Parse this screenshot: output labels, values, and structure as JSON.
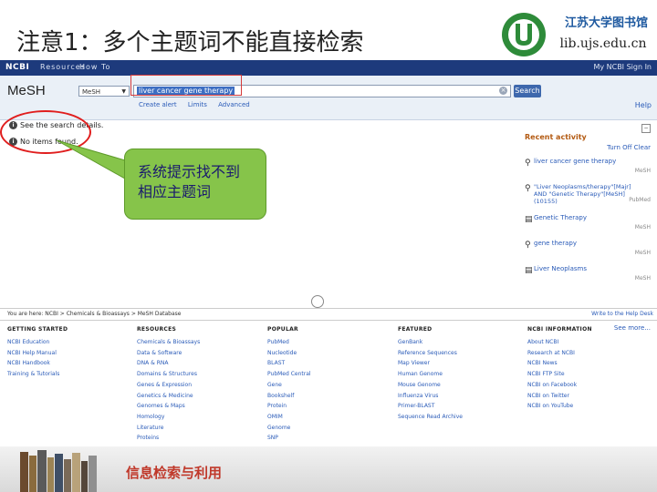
{
  "slide": {
    "title": "注意1：多个主题词不能直接检索",
    "library_name": "江苏大学图书馆",
    "library_url": "lib.ujs.edu.cn",
    "caption": "信息检索与利用"
  },
  "ncbi_bar": {
    "logo": "NCBI",
    "resources": "Resources",
    "how_to": "How To",
    "sign_in": "My NCBI Sign In"
  },
  "search": {
    "db_title": "MeSH",
    "db_selected": "MeSH",
    "query": "liver cancer gene therapy",
    "button": "Search",
    "sub_links": [
      "Create alert",
      "Limits",
      "Advanced"
    ],
    "help": "Help"
  },
  "info": {
    "items": [
      "See the search details.",
      "No items found."
    ]
  },
  "callout": {
    "line1": "系统提示找不到",
    "line2": "相应主题词"
  },
  "recent": {
    "title": "Recent activity",
    "links": "Turn Off  Clear",
    "items": [
      {
        "text": "liver cancer gene therapy",
        "type": "MeSH"
      },
      {
        "text": "\"Liver Neoplasms/therapy\"[Majr] AND \"Genetic Therapy\"[MeSH] (10155)",
        "type": "PubMed"
      },
      {
        "text": "Genetic Therapy",
        "type": "MeSH"
      },
      {
        "text": "gene therapy",
        "type": "MeSH"
      },
      {
        "text": "Liver Neoplasms",
        "type": "MeSH"
      }
    ],
    "see_more": "See more..."
  },
  "footer": {
    "breadcrumb": "You are here: NCBI > Chemicals & Bioassays > MeSH Database",
    "right": "Write to the Help Desk",
    "columns": [
      {
        "head": "GETTING STARTED",
        "items": [
          "NCBI Education",
          "NCBI Help Manual",
          "NCBI Handbook",
          "Training & Tutorials"
        ]
      },
      {
        "head": "RESOURCES",
        "items": [
          "Chemicals & Bioassays",
          "Data & Software",
          "DNA & RNA",
          "Domains & Structures",
          "Genes & Expression",
          "Genetics & Medicine",
          "Genomes & Maps",
          "Homology",
          "Literature",
          "Proteins"
        ]
      },
      {
        "head": "POPULAR",
        "items": [
          "PubMed",
          "Nucleotide",
          "BLAST",
          "PubMed Central",
          "Gene",
          "Bookshelf",
          "Protein",
          "OMIM",
          "Genome",
          "SNP"
        ]
      },
      {
        "head": "FEATURED",
        "items": [
          "GenBank",
          "Reference Sequences",
          "Map Viewer",
          "Human Genome",
          "Mouse Genome",
          "Influenza Virus",
          "Primer-BLAST",
          "Sequence Read Archive"
        ]
      },
      {
        "head": "NCBI INFORMATION",
        "items": [
          "About NCBI",
          "Research at NCBI",
          "NCBI News",
          "NCBI FTP Site",
          "NCBI on Facebook",
          "NCBI on Twitter",
          "NCBI on YouTube"
        ]
      }
    ]
  },
  "colors": {
    "ncbi_blue": "#1d3a7c",
    "callout_green": "#86c44a",
    "highlight_red": "#e01e1e"
  }
}
